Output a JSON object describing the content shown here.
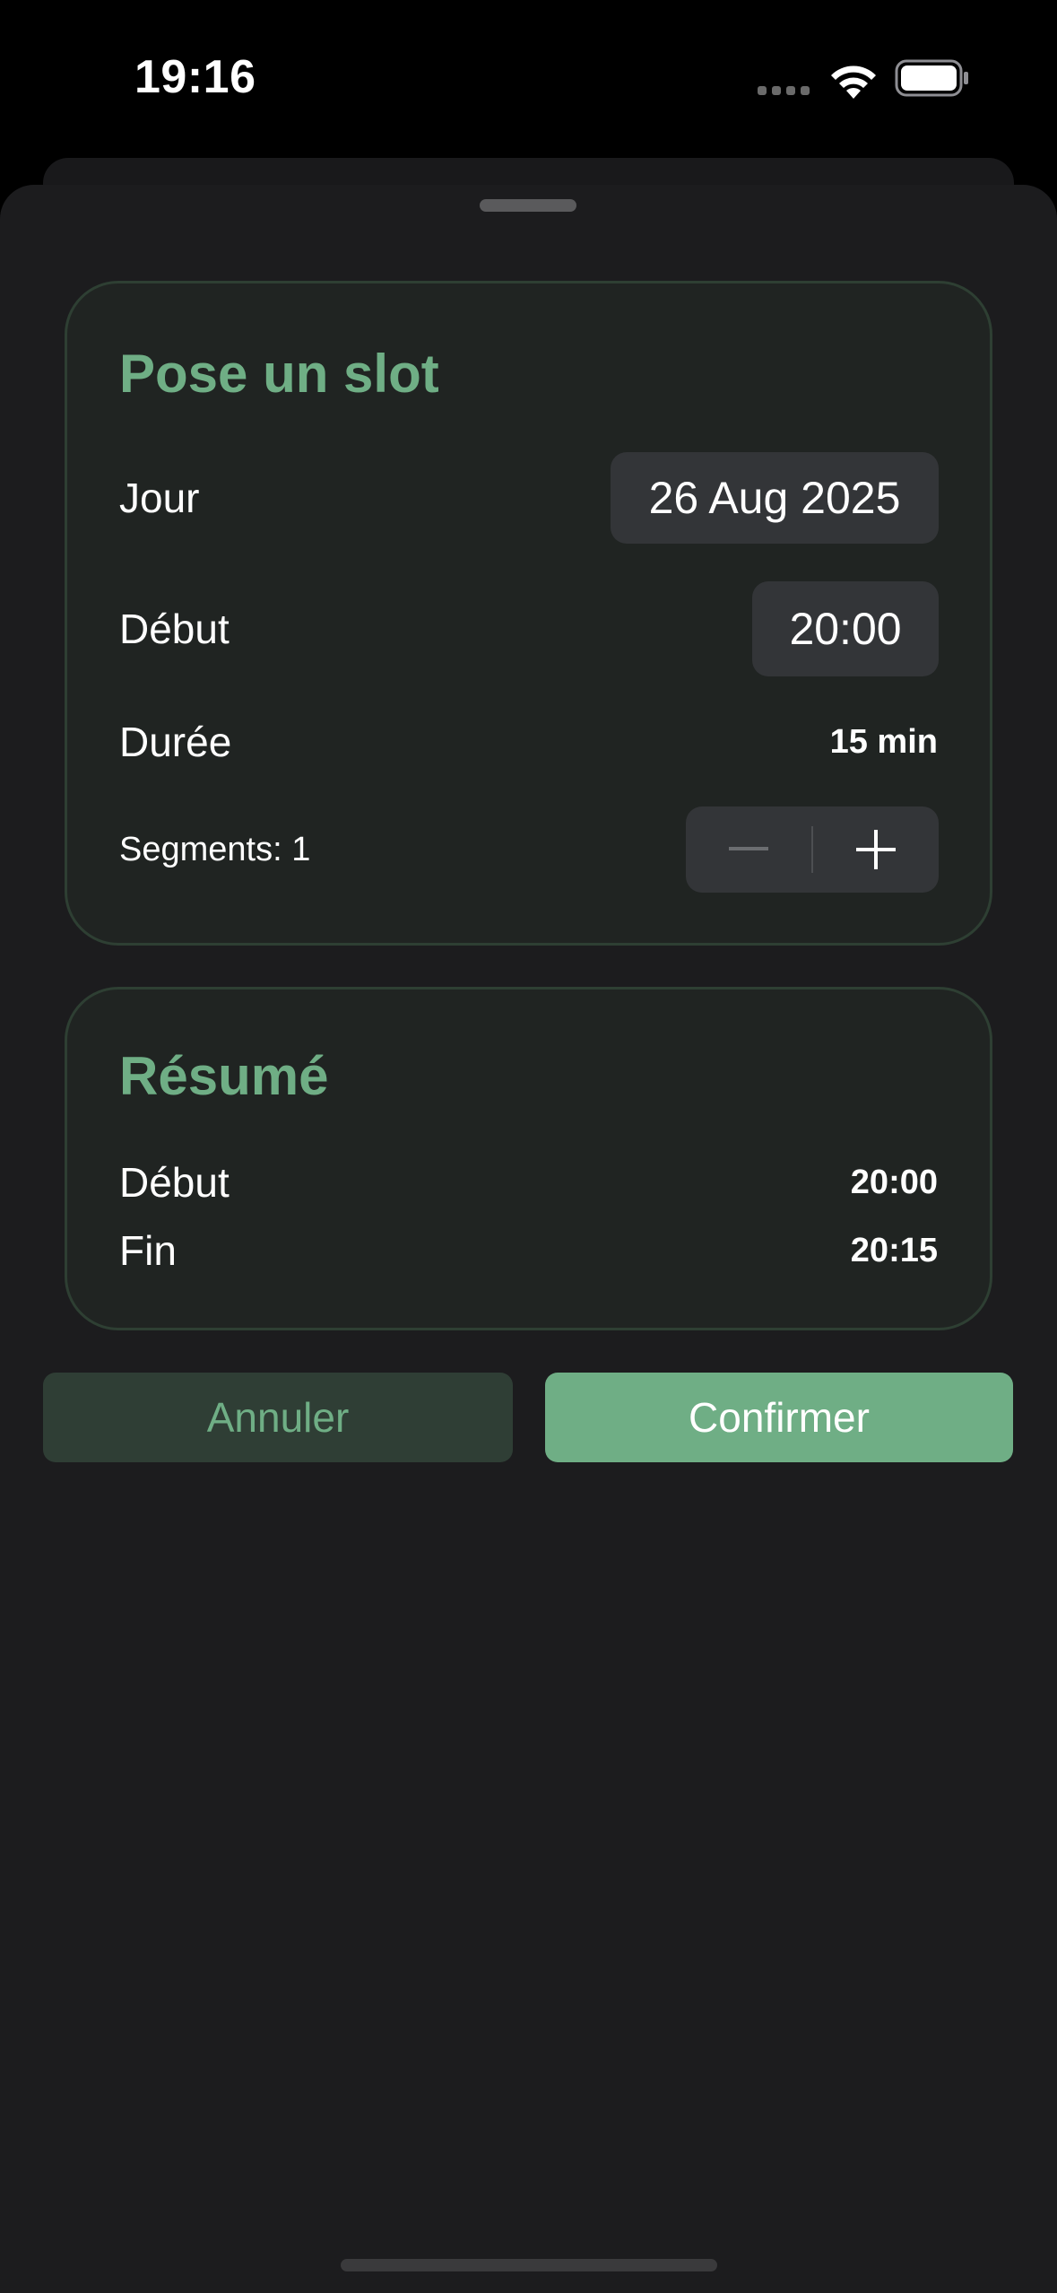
{
  "status_bar": {
    "time": "19:16"
  },
  "form_card": {
    "title": "Pose un slot",
    "day_label": "Jour",
    "day_value": "26 Aug 2025",
    "start_label": "Début",
    "start_value": "20:00",
    "duration_label": "Durée",
    "duration_value": "15 min",
    "segments_label": "Segments: 1",
    "stepper_minus": "—",
    "stepper_plus": "+"
  },
  "summary_card": {
    "title": "Résumé",
    "start_label": "Début",
    "start_value": "20:00",
    "end_label": "Fin",
    "end_value": "20:15"
  },
  "actions": {
    "cancel_label": "Annuler",
    "confirm_label": "Confirmer"
  },
  "colors": {
    "accent": "#6fae85",
    "background": "#1c1c1e",
    "card": "#202422",
    "control": "#333538"
  },
  "icons": [
    "cellular-signal-icon",
    "wifi-icon",
    "battery-icon",
    "minus-icon",
    "plus-icon"
  ]
}
